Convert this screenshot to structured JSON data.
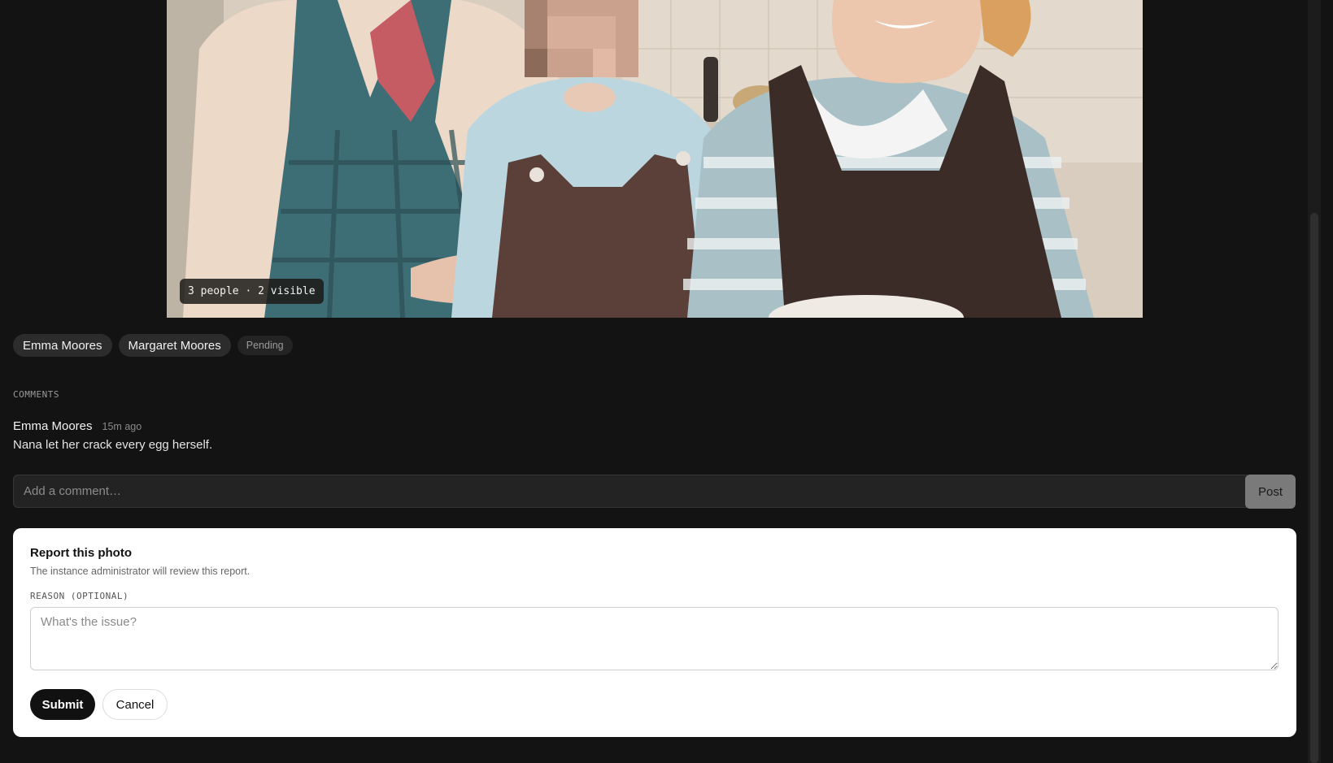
{
  "photo": {
    "people_badge": "3 people · 2 visible"
  },
  "tags": {
    "people": [
      "Emma Moores",
      "Margaret Moores"
    ],
    "status": "Pending"
  },
  "comments": {
    "section_label": "COMMENTS",
    "items": [
      {
        "author": "Emma Moores",
        "time": "15m ago",
        "body": "Nana let her crack every egg herself."
      }
    ],
    "input_placeholder": "Add a comment…",
    "post_label": "Post"
  },
  "report": {
    "title": "Report this photo",
    "subtitle": "The instance administrator will review this report.",
    "reason_label": "REASON (OPTIONAL)",
    "reason_placeholder": "What's the issue?",
    "submit_label": "Submit",
    "cancel_label": "Cancel"
  },
  "colors": {
    "background": "#131313",
    "card": "#ffffff",
    "primary_button": "#111111",
    "post_button": "#7a7a7a"
  }
}
